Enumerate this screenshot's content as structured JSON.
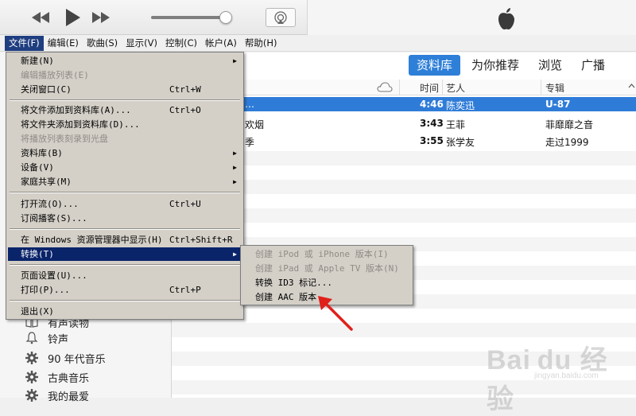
{
  "menubar": [
    "文件(F)",
    "编辑(E)",
    "歌曲(S)",
    "显示(V)",
    "控制(C)",
    "帐户(A)",
    "帮助(H)"
  ],
  "nav_tabs": [
    "资料库",
    "为你推荐",
    "浏览",
    "广播"
  ],
  "table": {
    "headers": {
      "time": "时间",
      "artist": "艺人",
      "album": "专辑"
    },
    "rows": [
      {
        "title": "…",
        "time": "4:46",
        "artist": "陈奕迅",
        "album": "U-87"
      },
      {
        "title": "欢烟",
        "time": "3:43",
        "artist": "王菲",
        "album": "菲靡靡之音"
      },
      {
        "title": "季",
        "time": "3:55",
        "artist": "张学友",
        "album": "走过1999"
      }
    ]
  },
  "sidebar": [
    {
      "label": "有声读物",
      "icon": "book-icon"
    },
    {
      "label": "铃声",
      "icon": "bell-icon"
    },
    {
      "label": "90 年代音乐",
      "icon": "gear-icon"
    },
    {
      "label": "古典音乐",
      "icon": "gear-icon"
    },
    {
      "label": "我的最爱",
      "icon": "gear-icon"
    }
  ],
  "file_menu": {
    "items": [
      {
        "label": "新建(N)",
        "shortcut": "",
        "submenu": true,
        "disabled": false
      },
      {
        "label": "编辑播放列表(E)",
        "shortcut": "",
        "submenu": false,
        "disabled": true
      },
      {
        "label": "关闭窗口(C)",
        "shortcut": "Ctrl+W",
        "submenu": false,
        "disabled": false
      },
      {
        "label": "将文件添加到资料库(A)...",
        "shortcut": "Ctrl+O",
        "submenu": false,
        "disabled": false
      },
      {
        "label": "将文件夹添加到资料库(D)...",
        "shortcut": "",
        "submenu": false,
        "disabled": false
      },
      {
        "label": "将播放列表刻录到光盘",
        "shortcut": "",
        "submenu": false,
        "disabled": true
      },
      {
        "label": "资料库(B)",
        "shortcut": "",
        "submenu": true,
        "disabled": false
      },
      {
        "label": "设备(V)",
        "shortcut": "",
        "submenu": true,
        "disabled": false
      },
      {
        "label": "家庭共享(M)",
        "shortcut": "",
        "submenu": true,
        "disabled": false
      },
      {
        "label": "打开流(O)...",
        "shortcut": "Ctrl+U",
        "submenu": false,
        "disabled": false
      },
      {
        "label": "订阅播客(S)...",
        "shortcut": "",
        "submenu": false,
        "disabled": false
      },
      {
        "label": "在 Windows 资源管理器中显示(H)",
        "shortcut": "Ctrl+Shift+R",
        "submenu": false,
        "disabled": false
      },
      {
        "label": "转换(T)",
        "shortcut": "",
        "submenu": true,
        "disabled": false
      },
      {
        "label": "页面设置(U)...",
        "shortcut": "",
        "submenu": false,
        "disabled": false
      },
      {
        "label": "打印(P)...",
        "shortcut": "Ctrl+P",
        "submenu": false,
        "disabled": false
      },
      {
        "label": "退出(X)",
        "shortcut": "",
        "submenu": false,
        "disabled": false
      }
    ]
  },
  "convert_submenu": [
    {
      "label": "创建 iPod 或 iPhone 版本(I)",
      "disabled": true
    },
    {
      "label": "创建 iPad 或 Apple TV 版本(N)",
      "disabled": true
    },
    {
      "label": "转换 ID3 标记...",
      "disabled": false
    },
    {
      "label": "创建 AAC 版本",
      "disabled": false
    }
  ],
  "watermark": {
    "brand": "Bai du 经验",
    "site": "jingyan.baidu.com"
  },
  "colors": {
    "accent": "#2e7fd8",
    "menu_highlight": "#0a246a",
    "menu_bg": "#d4d0c8",
    "arrow": "#e0201a"
  }
}
